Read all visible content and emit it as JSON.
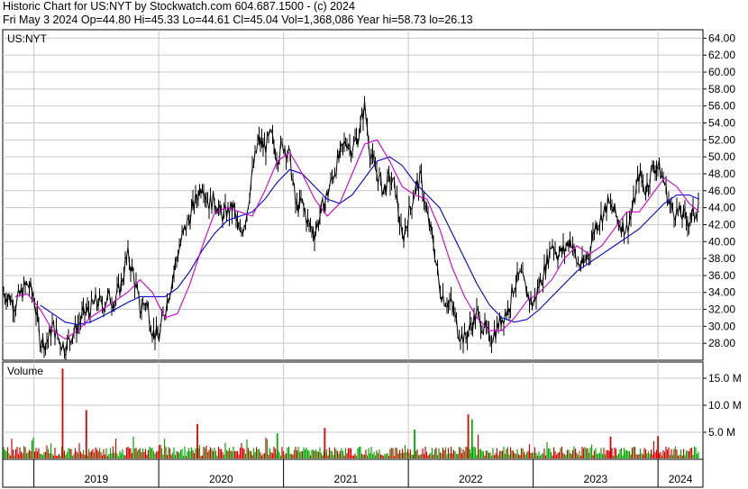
{
  "header": {
    "line1": "Historic Chart for US:NYT by Stockwatch.com 604.687.1500 - (c) 2024",
    "line2": "Fri May  3 2024  Op=44.80  Hi=45.33  Lo=44.61  Cl=45.04  Vol=1,368,086  Year hi=58.73  lo=26.13"
  },
  "chart_data": [
    {
      "type": "line",
      "title": "US:NYT",
      "ylim": [
        26,
        65
      ],
      "yticks": [
        "28.00",
        "30.00",
        "32.00",
        "34.00",
        "36.00",
        "38.00",
        "40.00",
        "42.00",
        "44.00",
        "46.00",
        "48.00",
        "50.00",
        "52.00",
        "54.00",
        "56.00",
        "58.00",
        "60.00",
        "62.00",
        "64.00"
      ],
      "x_labels": [
        "2019",
        "2020",
        "2021",
        "2022",
        "2023",
        "2024"
      ],
      "grid": true,
      "colors": {
        "price": "#000000",
        "ma_short": "#cc00cc",
        "ma_long": "#0000cc",
        "grid": "#c8c8c8"
      },
      "series": [
        {
          "key": "price",
          "x": [
            2018.75,
            2018.8,
            2018.85,
            2018.9,
            2018.95,
            2019.0,
            2019.05,
            2019.1,
            2019.15,
            2019.2,
            2019.25,
            2019.3,
            2019.35,
            2019.4,
            2019.45,
            2019.5,
            2019.55,
            2019.6,
            2019.65,
            2019.7,
            2019.75,
            2019.8,
            2019.85,
            2019.9,
            2019.95,
            2020.0,
            2020.05,
            2020.1,
            2020.15,
            2020.2,
            2020.25,
            2020.3,
            2020.35,
            2020.4,
            2020.45,
            2020.5,
            2020.55,
            2020.6,
            2020.65,
            2020.7,
            2020.75,
            2020.8,
            2020.85,
            2020.9,
            2020.95,
            2021.0,
            2021.05,
            2021.1,
            2021.15,
            2021.2,
            2021.25,
            2021.3,
            2021.35,
            2021.4,
            2021.45,
            2021.5,
            2021.55,
            2021.6,
            2021.65,
            2021.7,
            2021.75,
            2021.8,
            2021.85,
            2021.9,
            2021.95,
            2022.0,
            2022.05,
            2022.1,
            2022.15,
            2022.2,
            2022.25,
            2022.3,
            2022.35,
            2022.4,
            2022.45,
            2022.5,
            2022.55,
            2022.6,
            2022.65,
            2022.7,
            2022.75,
            2022.8,
            2022.85,
            2022.9,
            2022.95,
            2023.0,
            2023.05,
            2023.1,
            2023.15,
            2023.2,
            2023.25,
            2023.3,
            2023.35,
            2023.4,
            2023.45,
            2023.5,
            2023.55,
            2023.6,
            2023.65,
            2023.7,
            2023.75,
            2023.8,
            2023.85,
            2023.9,
            2023.95,
            2024.0,
            2024.05,
            2024.1,
            2024.15,
            2024.2,
            2024.25,
            2024.3,
            2024.33
          ],
          "values": [
            34.0,
            33.5,
            32.5,
            34.0,
            35.0,
            33.5,
            28.5,
            28.0,
            30.0,
            28.5,
            27.5,
            29.0,
            30.0,
            31.5,
            32.0,
            33.0,
            32.5,
            33.5,
            33.0,
            35.0,
            38.5,
            36.0,
            32.0,
            33.0,
            29.5,
            28.5,
            32.0,
            35.0,
            38.5,
            41.0,
            43.0,
            45.0,
            47.0,
            44.5,
            45.0,
            43.0,
            43.5,
            44.0,
            40.5,
            43.0,
            48.0,
            52.0,
            51.0,
            52.5,
            50.0,
            51.5,
            50.0,
            44.0,
            44.5,
            42.0,
            41.0,
            43.5,
            45.5,
            48.0,
            50.0,
            52.0,
            51.0,
            52.5,
            56.0,
            50.0,
            48.0,
            46.0,
            47.5,
            46.0,
            40.0,
            43.0,
            46.0,
            47.5,
            43.0,
            40.0,
            34.5,
            33.0,
            32.5,
            29.5,
            28.5,
            30.0,
            31.5,
            30.0,
            28.5,
            29.5,
            31.0,
            32.0,
            35.0,
            36.0,
            34.0,
            32.5,
            35.0,
            37.0,
            40.0,
            38.5,
            39.0,
            40.5,
            37.5,
            37.0,
            39.0,
            42.0,
            43.0,
            44.5,
            43.5,
            42.0,
            41.5,
            44.0,
            48.0,
            46.0,
            48.5,
            49.0,
            47.0,
            44.0,
            43.5,
            43.0,
            42.5,
            43.5,
            45.04
          ]
        },
        {
          "key": "ma_short",
          "x": [
            2018.85,
            2018.95,
            2019.05,
            2019.15,
            2019.25,
            2019.35,
            2019.45,
            2019.55,
            2019.65,
            2019.75,
            2019.85,
            2019.95,
            2020.05,
            2020.15,
            2020.25,
            2020.35,
            2020.45,
            2020.55,
            2020.65,
            2020.75,
            2020.85,
            2020.95,
            2021.05,
            2021.15,
            2021.25,
            2021.35,
            2021.45,
            2021.55,
            2021.65,
            2021.75,
            2021.85,
            2021.95,
            2022.05,
            2022.15,
            2022.25,
            2022.35,
            2022.45,
            2022.55,
            2022.65,
            2022.75,
            2022.85,
            2022.95,
            2023.05,
            2023.15,
            2023.25,
            2023.35,
            2023.45,
            2023.55,
            2023.65,
            2023.75,
            2023.85,
            2023.95,
            2024.05,
            2024.15,
            2024.25,
            2024.33
          ],
          "values": [
            33.5,
            33.8,
            32.0,
            29.5,
            28.5,
            29.5,
            31.0,
            32.0,
            33.0,
            34.0,
            35.5,
            34.0,
            31.0,
            31.5,
            35.0,
            39.5,
            43.5,
            44.0,
            43.5,
            43.0,
            46.0,
            49.5,
            50.5,
            48.0,
            45.0,
            43.0,
            44.5,
            48.0,
            51.5,
            52.0,
            49.5,
            46.5,
            45.5,
            45.0,
            41.5,
            37.0,
            33.5,
            31.0,
            29.5,
            29.5,
            31.0,
            33.0,
            34.0,
            35.5,
            38.0,
            39.5,
            38.5,
            39.5,
            41.5,
            43.5,
            43.5,
            45.5,
            47.5,
            46.5,
            44.5,
            43.5
          ]
        },
        {
          "key": "ma_long",
          "x": [
            2019.05,
            2019.15,
            2019.25,
            2019.35,
            2019.45,
            2019.55,
            2019.65,
            2019.75,
            2019.85,
            2019.95,
            2020.05,
            2020.15,
            2020.25,
            2020.35,
            2020.45,
            2020.55,
            2020.65,
            2020.75,
            2020.85,
            2020.95,
            2021.05,
            2021.15,
            2021.25,
            2021.35,
            2021.45,
            2021.55,
            2021.65,
            2021.75,
            2021.85,
            2021.95,
            2022.05,
            2022.15,
            2022.25,
            2022.35,
            2022.45,
            2022.55,
            2022.65,
            2022.75,
            2022.85,
            2022.95,
            2023.05,
            2023.15,
            2023.25,
            2023.35,
            2023.45,
            2023.55,
            2023.65,
            2023.75,
            2023.85,
            2023.95,
            2024.05,
            2024.15,
            2024.25,
            2024.33
          ],
          "values": [
            32.5,
            31.5,
            30.5,
            30.2,
            30.5,
            31.2,
            32.0,
            32.8,
            33.5,
            33.5,
            33.5,
            34.5,
            36.5,
            39.0,
            41.0,
            42.5,
            43.0,
            43.5,
            45.0,
            47.0,
            48.5,
            48.0,
            46.5,
            45.0,
            44.5,
            45.5,
            47.5,
            49.5,
            50.0,
            49.0,
            47.0,
            45.5,
            44.0,
            41.0,
            38.0,
            35.0,
            32.5,
            31.0,
            30.5,
            30.8,
            32.0,
            33.5,
            35.0,
            36.5,
            37.5,
            38.5,
            39.5,
            40.5,
            41.5,
            43.0,
            44.5,
            45.5,
            45.5,
            45.0
          ]
        }
      ]
    },
    {
      "type": "bar",
      "title": "Volume",
      "ylim": [
        0,
        18000000
      ],
      "yticks": [
        "5.0 M",
        "10.0 M",
        "15.0 M"
      ],
      "colors": {
        "up": "#00aa00",
        "down": "#dd0000"
      },
      "series": [
        {
          "key": "volume",
          "spikes": [
            {
              "x": 2019.23,
              "value": 16800000,
              "dir": "down"
            },
            {
              "x": 2019.42,
              "value": 9100000,
              "dir": "down"
            },
            {
              "x": 2020.31,
              "value": 6500000,
              "dir": "down"
            },
            {
              "x": 2021.33,
              "value": 5800000,
              "dir": "down"
            },
            {
              "x": 2022.05,
              "value": 5500000,
              "dir": "up"
            },
            {
              "x": 2022.48,
              "value": 8300000,
              "dir": "down"
            },
            {
              "x": 2022.51,
              "value": 7400000,
              "dir": "up"
            },
            {
              "x": 2020.95,
              "value": 4800000,
              "dir": "up"
            },
            {
              "x": 2023.62,
              "value": 4200000,
              "dir": "down"
            },
            {
              "x": 2024.0,
              "value": 4300000,
              "dir": "down"
            }
          ]
        }
      ]
    }
  ]
}
